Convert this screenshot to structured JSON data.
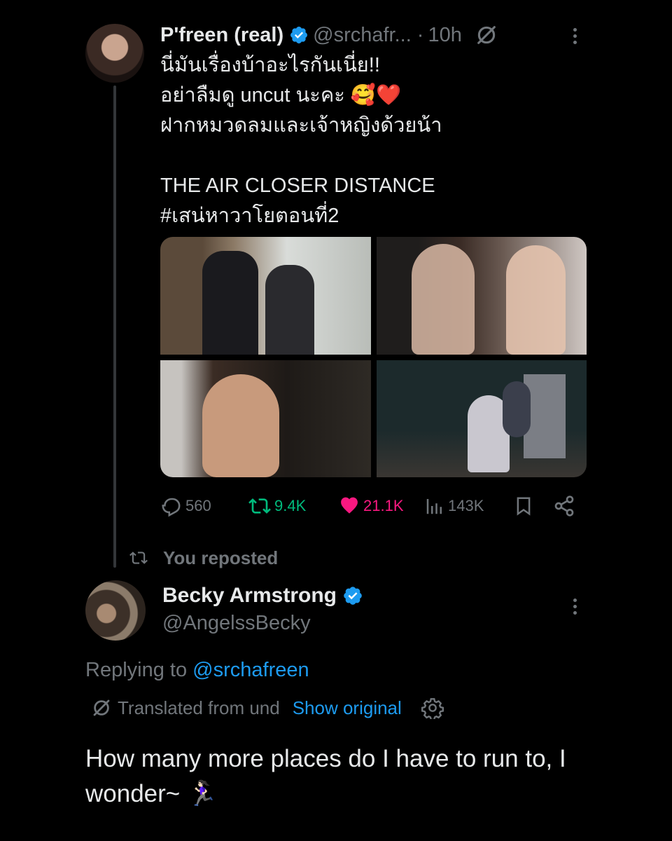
{
  "tweet1": {
    "author_name": "P'freen (real)",
    "handle": "@srchafr...",
    "separator": "·",
    "time": "10h",
    "lines": [
      "นี่มันเรื่องบ้าอะไรกันเนี่ย!!",
      "อย่าลืมดู uncut นะคะ 🥰❤️",
      "ฝากหมวดลมและเจ้าหญิงด้วยน้า"
    ],
    "line_title": "THE AIR CLOSER DISTANCE",
    "hashtag": "#เสน่หาวาโยตอนที่2",
    "stats": {
      "replies": "560",
      "reposts": "9.4K",
      "likes": "21.1K",
      "views": "143K"
    },
    "icons": [
      "verified-badge-icon",
      "translate-icon",
      "more-icon",
      "reply-icon",
      "repost-icon",
      "heart-icon",
      "views-icon",
      "bookmark-icon",
      "share-icon"
    ]
  },
  "repost_banner": {
    "label": "You reposted"
  },
  "tweet2": {
    "author_name": "Becky Armstrong",
    "handle": "@AngelssBecky",
    "replying_prefix": "Replying to ",
    "replying_handle": "@srchafreen",
    "translated_label": "Translated from und",
    "show_original": "Show original",
    "text": "How many more places do I have to run to, I wonder~ 🏃🏻‍♀️"
  },
  "colors": {
    "background": "#000000",
    "text": "#e7e9ea",
    "muted": "#71767b",
    "accent": "#1d9bf0",
    "repost": "#00ba7c",
    "like": "#f91880"
  }
}
